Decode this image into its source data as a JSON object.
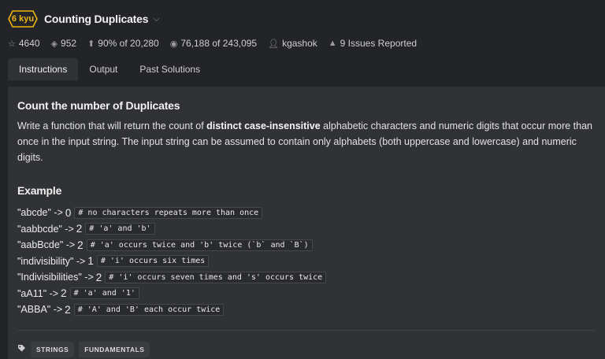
{
  "kata": {
    "rank": "6 kyu",
    "title": "Counting Duplicates",
    "chevron": "⌵"
  },
  "stats": {
    "stars": "4640",
    "collections": "952",
    "satisfaction": "90%",
    "satisfaction_sub": "of 20,280",
    "completed": "76,188",
    "completed_sub": "of 243,095",
    "author": "kgashok",
    "issues": "9 Issues Reported"
  },
  "tabs": [
    {
      "label": "Instructions",
      "active": true
    },
    {
      "label": "Output",
      "active": false
    },
    {
      "label": "Past Solutions",
      "active": false
    }
  ],
  "instructions": {
    "heading": "Count the number of Duplicates",
    "desc_pre": "Write a function that will return the count of ",
    "desc_bold": "distinct case-insensitive",
    "desc_post": " alphabetic characters and numeric digits that occur more than once in the input string. The input string can be assumed to contain only alphabets (both uppercase and lowercase) and numeric digits.",
    "example_heading": "Example",
    "examples": [
      {
        "input": "\"abcde\" ->",
        "result": "0",
        "comment": "# no characters repeats more than once"
      },
      {
        "input": "\"aabbcde\" ->",
        "result": "2",
        "comment": "# 'a' and 'b'"
      },
      {
        "input": "\"aabBcde\" ->",
        "result": "2",
        "comment": "# 'a' occurs twice and 'b' twice (`b` and `B`)"
      },
      {
        "input": "\"indivisibility\" ->",
        "result": "1",
        "comment": "# 'i' occurs six times"
      },
      {
        "input": "\"Indivisibilities\" ->",
        "result": "2",
        "comment": "# 'i' occurs seven times and 's' occurs twice"
      },
      {
        "input": "\"aA11\" ->",
        "result": "2",
        "comment": "# 'a' and '1'"
      },
      {
        "input": "\"ABBA\" ->",
        "result": "2",
        "comment": "# 'A' and 'B' each occur twice"
      }
    ]
  },
  "tags": [
    "STRINGS",
    "FUNDAMENTALS"
  ],
  "colors": {
    "accent": "#ecb613",
    "background": "#232427",
    "panel": "#303235"
  },
  "icons": {
    "star": "star-icon",
    "collection": "stack-icon",
    "satisfaction": "thumbs-up-icon",
    "completed": "target-icon",
    "author": "user-icon",
    "issues": "warning-icon",
    "tag": "tag-icon"
  }
}
